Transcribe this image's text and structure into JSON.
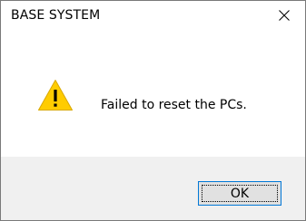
{
  "window": {
    "title": "BASE SYSTEM"
  },
  "titlebar": {
    "close_icon": "close-icon"
  },
  "content": {
    "icon": "warning-icon",
    "icon_color": "#ffcc00",
    "message": "Failed to reset the PCs."
  },
  "footer": {
    "ok_label": "OK"
  },
  "colors": {
    "footer_background": "#f0f0f0",
    "button_focus_border": "#0078d7",
    "button_background": "#e1e1e1"
  }
}
